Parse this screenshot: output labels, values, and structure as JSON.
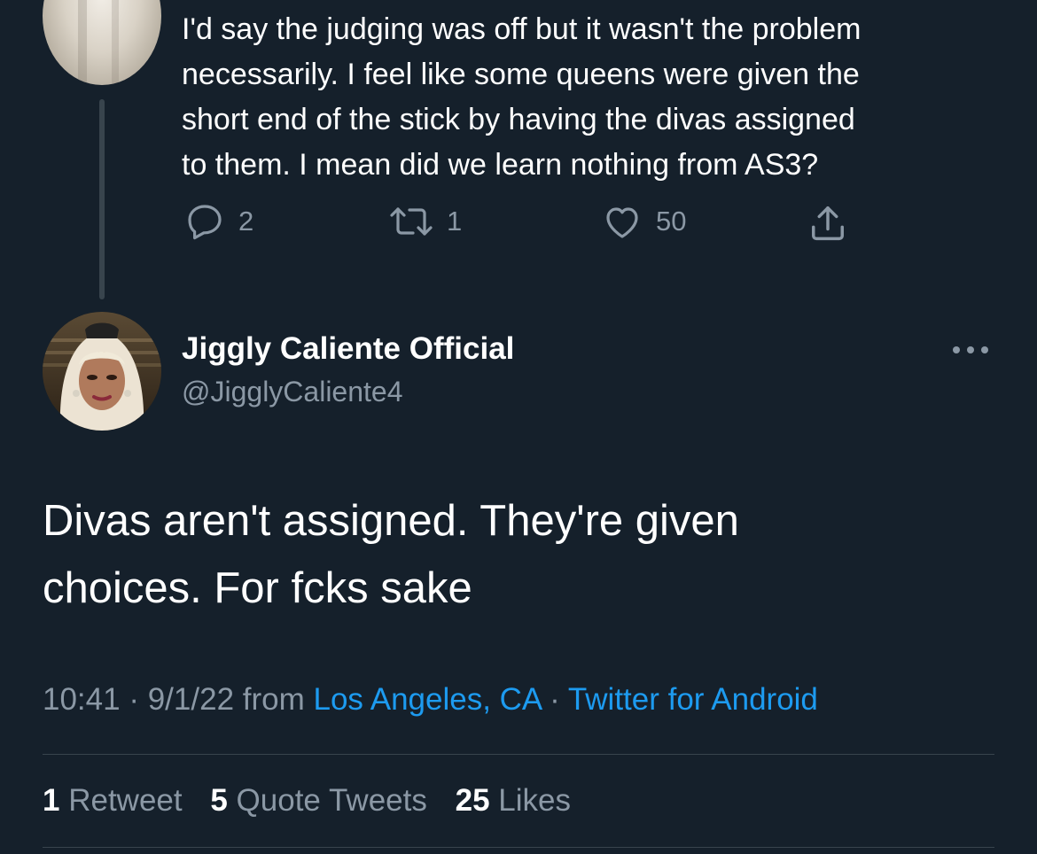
{
  "parent_tweet": {
    "text": "I'd say the judging was off but it wasn't the problem\nnecessarily. I feel like some queens were given the\nshort end of the stick by having the divas assigned\nto them. I mean did we learn nothing from AS3?",
    "actions": {
      "reply_count": "2",
      "retweet_count": "1",
      "like_count": "50"
    }
  },
  "main_tweet": {
    "display_name": "Jiggly Caliente Official",
    "handle": "@JigglyCaliente4",
    "text": "Divas aren't assigned. They're given\nchoices. For fcks sake",
    "meta": {
      "time": "10:41",
      "separator": "·",
      "date": "9/1/22",
      "from_label": "from",
      "location": "Los Angeles, CA",
      "source": "Twitter for Android"
    },
    "stats": {
      "retweets_count": "1",
      "retweets_label": "Retweet",
      "quotes_count": "5",
      "quotes_label": "Quote Tweets",
      "likes_count": "25",
      "likes_label": "Likes"
    }
  },
  "colors": {
    "background": "#15202b",
    "text_primary": "#ffffff",
    "text_secondary": "#8b98a5",
    "link": "#1d9bf0",
    "divider": "#38444d"
  },
  "icons": [
    "reply-icon",
    "retweet-icon",
    "like-icon",
    "share-icon",
    "more-options-icon"
  ]
}
